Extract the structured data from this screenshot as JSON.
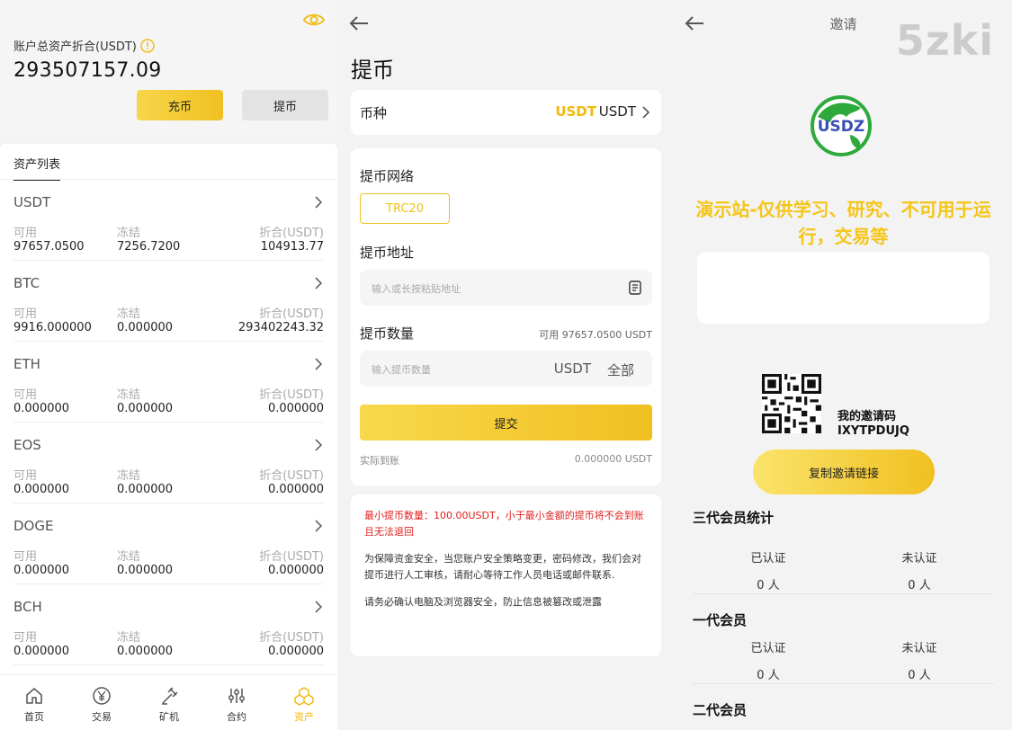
{
  "assets_page": {
    "total_label": "账户总资产折合(USDT)",
    "total_value": "293507157.09",
    "deposit_label": "充币",
    "withdraw_label": "提币",
    "list_tab": "资产列表",
    "col_available": "可用",
    "col_frozen": "冻结",
    "col_equivalent": "折合(USDT)",
    "assets": [
      {
        "name": "USDT",
        "available": "97657.0500",
        "frozen": "7256.7200",
        "equivalent": "104913.77"
      },
      {
        "name": "BTC",
        "available": "9916.000000",
        "frozen": "0.000000",
        "equivalent": "293402243.32"
      },
      {
        "name": "ETH",
        "available": "0.000000",
        "frozen": "0.000000",
        "equivalent": "0.000000"
      },
      {
        "name": "EOS",
        "available": "0.000000",
        "frozen": "0.000000",
        "equivalent": "0.000000"
      },
      {
        "name": "DOGE",
        "available": "0.000000",
        "frozen": "0.000000",
        "equivalent": "0.000000"
      },
      {
        "name": "BCH",
        "available": "0.000000",
        "frozen": "0.000000",
        "equivalent": "0.000000"
      }
    ],
    "tabbar": [
      {
        "label": "首页",
        "icon": "home-icon"
      },
      {
        "label": "交易",
        "icon": "yen-icon"
      },
      {
        "label": "矿机",
        "icon": "miner-icon"
      },
      {
        "label": "合约",
        "icon": "sliders-icon"
      },
      {
        "label": "资产",
        "icon": "cubes-icon"
      }
    ]
  },
  "withdraw_page": {
    "title": "提币",
    "coin_label": "币种",
    "coin_symbol_highlight": "USDT",
    "coin_symbol": "USDT",
    "network_label": "提币网络",
    "network_chip": "TRC20",
    "address_label": "提币地址",
    "address_placeholder": "输入或长按粘贴地址",
    "amount_label": "提币数量",
    "available_text": "可用   97657.0500 USDT",
    "amount_placeholder": "输入提币数量",
    "amount_unit": "USDT",
    "amount_all": "全部",
    "submit_label": "提交",
    "actual_label": "实际到账",
    "actual_value": "0.000000   USDT",
    "notice_red": "最小提币数量：100.00USDT，小于最小金额的提币将不会到账且无法退回",
    "notice_1": "为保障资金安全，当您账户安全策略变更，密码修改，我们会对提币进行人工审核，请耐心等待工作人员电话或邮件联系.",
    "notice_2": "请务必确认电脑及浏览器安全，防止信息被篡改或泄露"
  },
  "invite_page": {
    "title": "邀请",
    "brand": "5zki",
    "logo_text": "USDZ",
    "headline": "演示站-仅供学习、研究、不可用于运行，交易等",
    "invite_label": "我的邀请码",
    "invite_code": "IXYTPDUJQ",
    "copy_label": "复制邀请链接",
    "sections": [
      {
        "title": "三代会员统计",
        "verified_label": "已认证",
        "unverified_label": "未认证",
        "verified": "0 人",
        "unverified": "0 人"
      },
      {
        "title": "一代会员",
        "verified_label": "已认证",
        "unverified_label": "未认证",
        "verified": "0 人",
        "unverified": "0 人"
      },
      {
        "title": "二代会员"
      }
    ]
  },
  "colors": {
    "accent": "#f0c020",
    "headline": "#f5c518",
    "danger": "#e02020"
  }
}
